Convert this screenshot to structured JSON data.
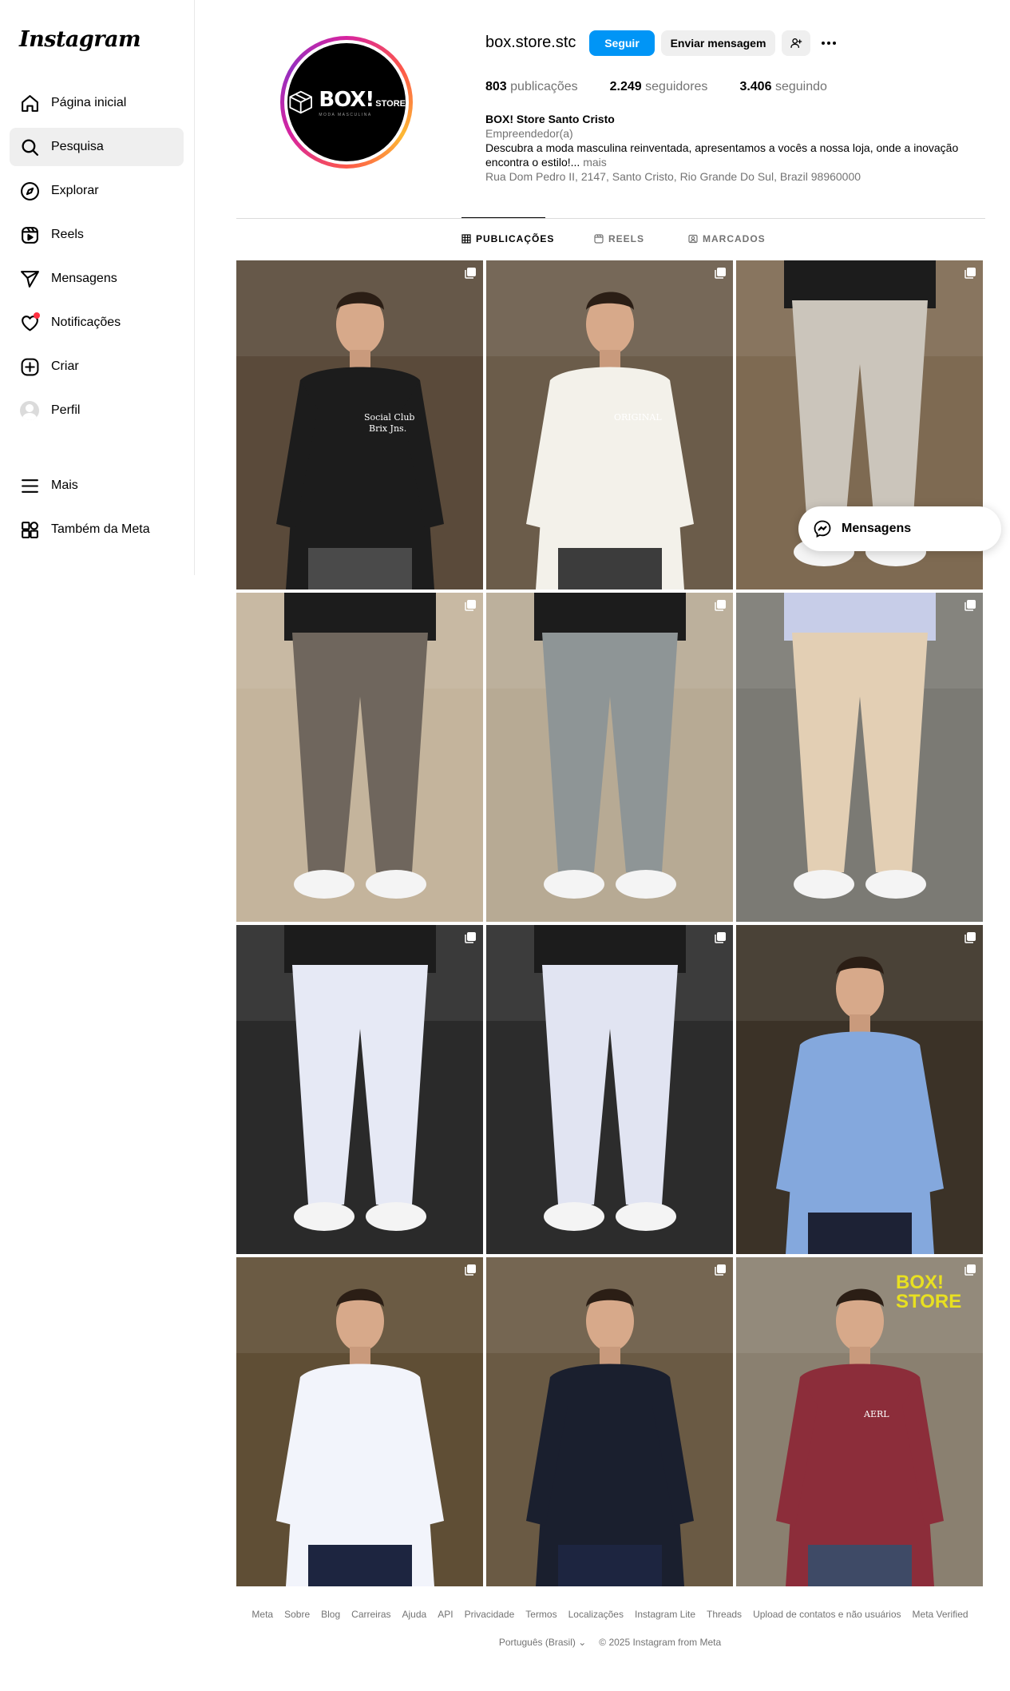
{
  "app": {
    "logo_text": "Instagram"
  },
  "sidebar": {
    "items": [
      {
        "label": "Página inicial",
        "icon": "home-icon"
      },
      {
        "label": "Pesquisa",
        "icon": "search-icon"
      },
      {
        "label": "Explorar",
        "icon": "compass-icon"
      },
      {
        "label": "Reels",
        "icon": "reels-icon"
      },
      {
        "label": "Mensagens",
        "icon": "send-icon"
      },
      {
        "label": "Notificações",
        "icon": "heart-icon"
      },
      {
        "label": "Criar",
        "icon": "plus-square-icon"
      },
      {
        "label": "Perfil",
        "icon": "avatar"
      }
    ],
    "bottom_items": [
      {
        "label": "Mais",
        "icon": "menu-icon"
      },
      {
        "label": "Também da Meta",
        "icon": "meta-apps-icon"
      }
    ],
    "active_index": 1
  },
  "profile": {
    "username": "box.store.stc",
    "logo_main": "BOX!",
    "logo_small": "STORE",
    "logo_tagline": "MODA MASCULINA",
    "follow_label": "Seguir",
    "message_label": "Enviar mensagem",
    "stats": {
      "posts_count": "803",
      "posts_label": "publicações",
      "followers_count": "2.249",
      "followers_label": "seguidores",
      "following_count": "3.406",
      "following_label": "seguindo"
    },
    "bio": {
      "name": "BOX! Store Santo Cristo",
      "category": "Empreendedor(a)",
      "text": "Descubra a moda masculina reinventada, apresentamos a vocês a nossa loja, onde a inovação encontra o estilo!...",
      "more": "mais",
      "address": "Rua Dom Pedro II, 2147, Santo Cristo, Rio Grande Do Sul, Brazil 98960000"
    }
  },
  "tabs": [
    {
      "label": "PUBLICAÇÕES",
      "icon": "grid-icon"
    },
    {
      "label": "REELS",
      "icon": "reels-icon"
    },
    {
      "label": "MARCADOS",
      "icon": "tagged-icon"
    }
  ],
  "posts": [
    {
      "shirt_text_1": "Social Club",
      "shirt_text_2": "Brix Jns.",
      "shirt": "#1c1c1c",
      "pants": "#4a4a4a"
    },
    {
      "shirt_text_1": "ORIGINAL",
      "shirt_text_2": "",
      "shirt": "#f3f1ea",
      "pants": "#3c3c3c"
    },
    {
      "shirt_text_1": "",
      "shirt_text_2": "",
      "shirt": "#1c1c1c",
      "pants": "#cbc5bb"
    },
    {
      "shirt_text_1": "",
      "shirt_text_2": "",
      "shirt": "#1c1c1c",
      "pants": "#6f665d"
    },
    {
      "shirt_text_1": "",
      "shirt_text_2": "",
      "shirt": "#1c1c1c",
      "pants": "#8e9596"
    },
    {
      "shirt_text_1": "",
      "shirt_text_2": "",
      "shirt": "#c7cde8",
      "pants": "#e3cfb4"
    },
    {
      "shirt_text_1": "",
      "shirt_text_2": "",
      "shirt": "#1c1c1c",
      "pants": "#e6e9f5"
    },
    {
      "shirt_text_1": "",
      "shirt_text_2": "",
      "shirt": "#1c1c1c",
      "pants": "#e1e4f2"
    },
    {
      "shirt_text_1": "",
      "shirt_text_2": "",
      "shirt": "#84a8dd",
      "pants": "#1d2235"
    },
    {
      "shirt_text_1": "",
      "shirt_text_2": "",
      "shirt": "#f2f4fb",
      "pants": "#1d2540"
    },
    {
      "shirt_text_1": "",
      "shirt_text_2": "",
      "shirt": "#1a1f2e",
      "pants": "#1d2540"
    },
    {
      "shirt_text_1": "AERL",
      "shirt_text_2": "",
      "shirt": "#8c2d3a",
      "pants": "#3e4a66",
      "sign": "BOX! STORE"
    }
  ],
  "floating_messages": {
    "label": "Mensagens"
  },
  "footer": {
    "links": [
      "Meta",
      "Sobre",
      "Blog",
      "Carreiras",
      "Ajuda",
      "API",
      "Privacidade",
      "Termos",
      "Localizações",
      "Instagram Lite",
      "Threads",
      "Upload de contatos e não usuários",
      "Meta Verified"
    ],
    "language": "Português (Brasil)",
    "copyright": "© 2025 Instagram from Meta"
  }
}
